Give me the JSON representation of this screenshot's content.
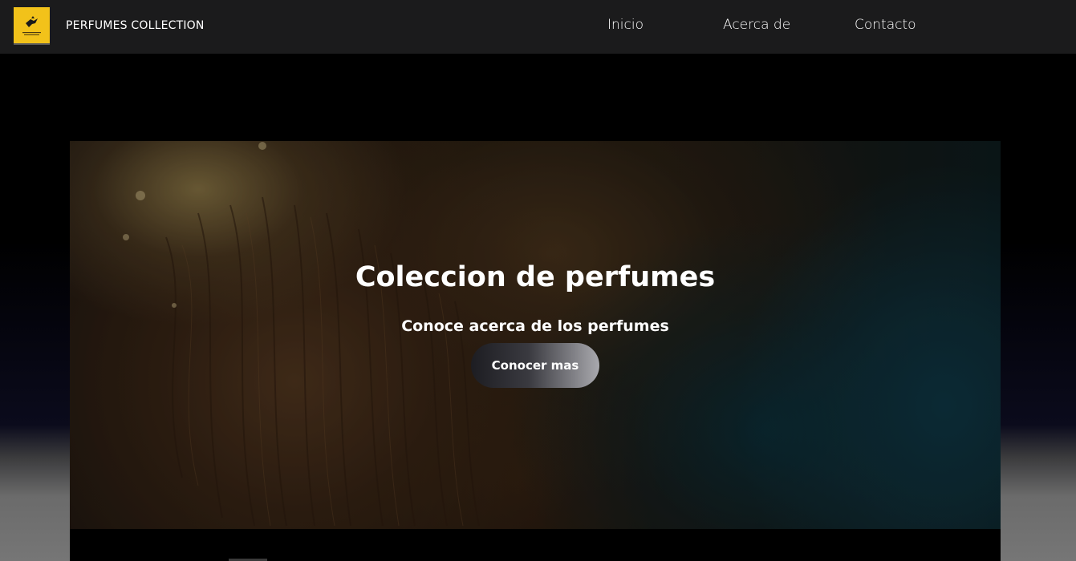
{
  "navbar": {
    "brand": "PERFUMES COLLECTION",
    "links": [
      {
        "label": "Inicio"
      },
      {
        "label": "Acerca de"
      },
      {
        "label": "Contacto"
      }
    ],
    "background_color": "#1b1b1c",
    "logo_icon": "perfume-logo-icon",
    "logo_color": "#f2c21a"
  },
  "hero": {
    "title": "Coleccion de perfumes",
    "subtitle": "Conoce acerca de los perfumes",
    "button_label": "Conocer mas",
    "image_subject": "hero-background-image"
  }
}
